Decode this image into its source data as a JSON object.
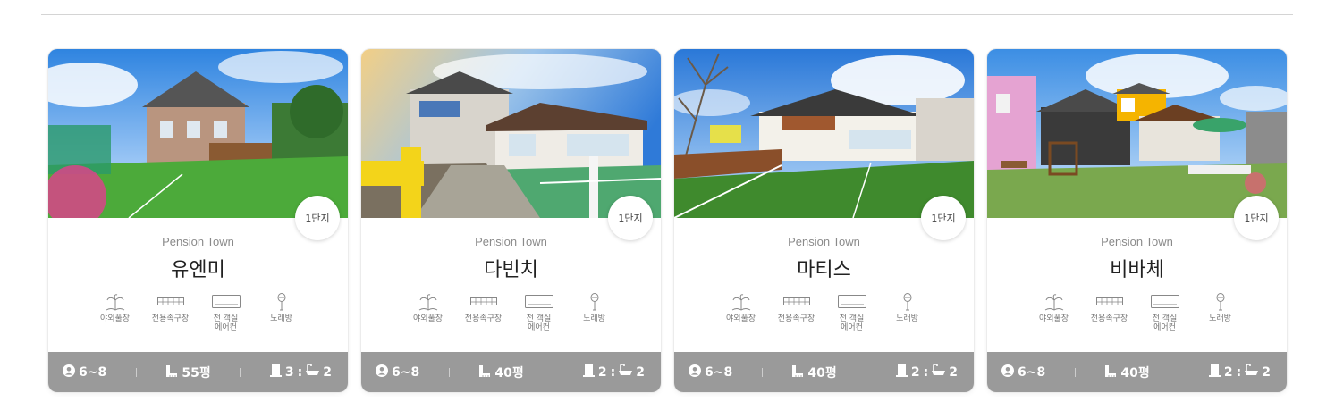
{
  "cards": [
    {
      "complex": "1단지",
      "subtitle": "Pension Town",
      "name": "유엔미",
      "amenities": [
        "야외풀장",
        "전용족구장",
        "전 객실\n에어컨",
        "노래방"
      ],
      "guests": "6~8",
      "area": "55평",
      "rooms": "3",
      "baths": "2"
    },
    {
      "complex": "1단지",
      "subtitle": "Pension Town",
      "name": "다빈치",
      "amenities": [
        "야외풀장",
        "전용족구장",
        "전 객실\n에어컨",
        "노래방"
      ],
      "guests": "6~8",
      "area": "40평",
      "rooms": "2",
      "baths": "2"
    },
    {
      "complex": "1단지",
      "subtitle": "Pension Town",
      "name": "마티스",
      "amenities": [
        "야외풀장",
        "전용족구장",
        "전 객실\n에어컨",
        "노래방"
      ],
      "guests": "6~8",
      "area": "40평",
      "rooms": "2",
      "baths": "2"
    },
    {
      "complex": "1단지",
      "subtitle": "Pension Town",
      "name": "비바체",
      "amenities": [
        "야외풀장",
        "전용족구장",
        "전 객실\n에어컨",
        "노래방"
      ],
      "guests": "6~8",
      "area": "40평",
      "rooms": "2",
      "baths": "2"
    }
  ],
  "icons": {
    "pool": "palm-tree-icon",
    "court": "court-icon",
    "aircon": "air-conditioner-icon",
    "karaoke": "microphone-icon",
    "guests": "user-circle-icon",
    "area": "ruler-icon",
    "rooms": "door-icon",
    "baths": "bathtub-icon"
  },
  "colors": {
    "footer": "#9a9a9a",
    "grass": "#4caa3a",
    "sky": "#3f8fe0"
  }
}
